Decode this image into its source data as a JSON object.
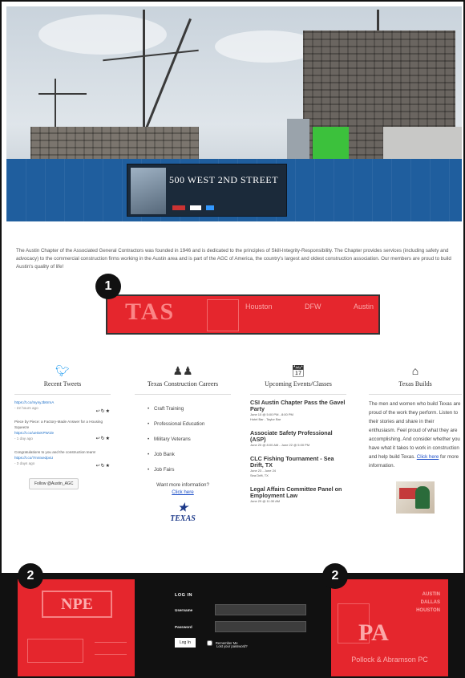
{
  "hero": {
    "banner_text": "500 WEST 2ND STREET"
  },
  "intro": {
    "text": "The Austin Chapter of the Associated General Contractors was founded in 1946 and is dedicated to the principles of Skill-Integrity-Responsibility. The Chapter provides services (including safety and advocacy) to the commercial construction firms working in the Austin area and is part of the AGC of America, the country's largest and oldest construction association. Our members are proud to build Austin's quality of life!"
  },
  "ads": {
    "tas": {
      "logo": "TAS",
      "cities": [
        "Houston",
        "DFW",
        "Austin"
      ]
    },
    "npe": {
      "logo": "NPE"
    },
    "pa": {
      "cities": [
        "AUSTIN",
        "DALLAS",
        "HOUSTON"
      ],
      "logo": "PA",
      "name": "Pollock & Abramson PC"
    }
  },
  "markers": [
    "1",
    "2",
    "2"
  ],
  "columns": {
    "tweets": {
      "title": "Recent Tweets",
      "items": [
        {
          "link": "https://t.co/mynyJb6rmA",
          "time": "- 22 hours ago"
        },
        {
          "text": "Piece by Piece: a Factory-Made Answer for a Housing Squeeze",
          "link": "https://t.co/ue0xKPW1le",
          "time": "- 1 day ago"
        },
        {
          "text": "Congratulations to you and the construction team!",
          "link": "https://t.co/7mnIxedpxU",
          "time": "- 3 days ago"
        }
      ],
      "follow": "Follow @Austin_AGC"
    },
    "careers": {
      "title": "Texas Construction Careers",
      "items": [
        "Craft Training",
        "Professional Education",
        "Military Veterans",
        "Job Bank",
        "Job Fairs"
      ],
      "more_text": "Want more information?",
      "more_link": "Click here",
      "logo": "TEXAS"
    },
    "events": {
      "title": "Upcoming Events/Classes",
      "items": [
        {
          "title": "CSI Austin Chapter Pass the Gavel Party",
          "meta": "June 10 @ 5:00 PM - 8:00 PM",
          "place": "Hotel Bar - Taylor Bar"
        },
        {
          "title": "Associate Safety Professional (ASP)",
          "meta": "June 20 @ 8:00 AM - June 22 @ 5:00 PM",
          "place": ""
        },
        {
          "title": "CLC Fishing Tournament - Sea Drift, TX",
          "meta": "June 23 - June 24",
          "place": "Sea Drift, TX"
        },
        {
          "title": "Legal Affairs Committee Panel on Employment Law",
          "meta": "June 29 @ 11:30 AM",
          "place": ""
        }
      ]
    },
    "builds": {
      "title": "Texas Builds",
      "text": "The men and women who build Texas are proud of the work they perform. Listen to their stories and share in their enthusiasm. Feel proud of what they are accomplishing. And consider whether you have what it takes to work in construction and help build Texas.",
      "link": "Click here",
      "after_link": "for more information."
    }
  },
  "login": {
    "title": "LOG IN",
    "username_label": "Username",
    "password_label": "Password",
    "button": "Log In",
    "remember": "Remember Me",
    "lost": "Lost your password?"
  }
}
